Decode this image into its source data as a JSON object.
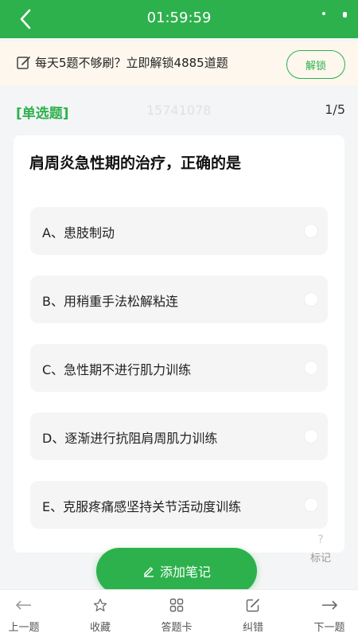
{
  "header": {
    "timer": "01:59:59",
    "back_icon": "chevron-left-icon"
  },
  "promo": {
    "text": "每天5题不够刷？立即解锁4885道题",
    "unlock_label": "解锁",
    "icon": "edit-icon"
  },
  "question": {
    "type_label": "[单选题]",
    "id": "15741078",
    "progress": "1/5",
    "title": "肩周炎急性期的治疗，正确的是",
    "options": [
      "A、患肢制动",
      "B、用稍重手法松解粘连",
      "C、急性期不进行肌力训练",
      "D、逐渐进行抗阻肩周肌力训练",
      "E、克服疼痛感坚持关节活动度训练"
    ]
  },
  "mark": {
    "glyph": "?",
    "label": "标记"
  },
  "add_note": {
    "label": "添加笔记"
  },
  "bottom_nav": {
    "prev": "上一题",
    "favorite": "收藏",
    "answer_card": "答题卡",
    "report_error": "纠错",
    "next": "下一题"
  },
  "colors": {
    "accent": "#2db14d",
    "promo_bg": "#fdf7ee",
    "page_bg": "#f4f5f6"
  }
}
